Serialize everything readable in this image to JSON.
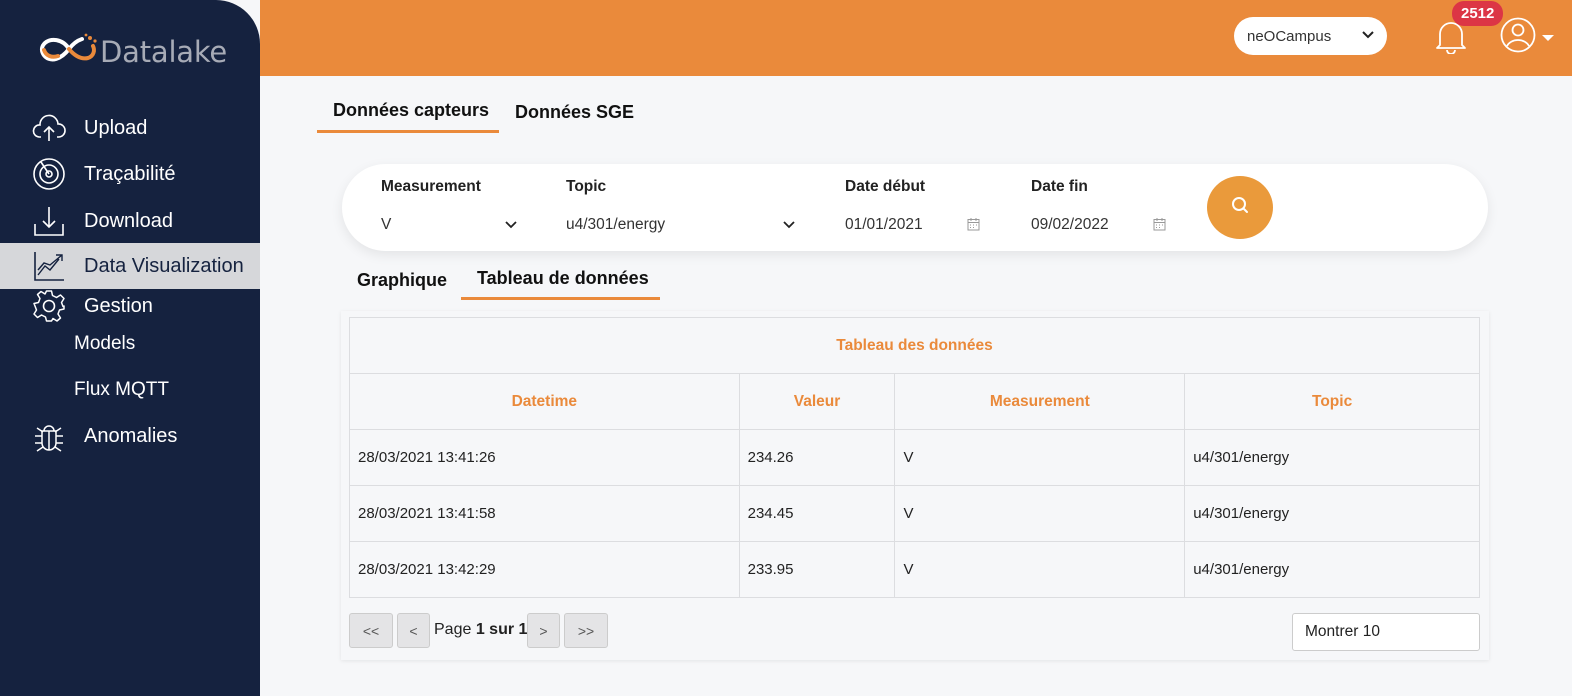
{
  "brand": {
    "name": "Datalake"
  },
  "sidebar": {
    "items": [
      {
        "label": "Upload",
        "icon": "cloud-upload-icon"
      },
      {
        "label": "Traçabilité",
        "icon": "radar-icon"
      },
      {
        "label": "Download",
        "icon": "download-icon"
      },
      {
        "label": "Data Visualization",
        "icon": "chart-line-icon",
        "active": true
      },
      {
        "label": "Gestion",
        "icon": "gear-icon"
      },
      {
        "label": "Anomalies",
        "icon": "bug-icon"
      }
    ],
    "sub_items": [
      {
        "label": "Models"
      },
      {
        "label": "Flux MQTT"
      }
    ]
  },
  "topbar": {
    "org_select": "neOCampus",
    "notification_count": "2512",
    "accent_color": "#ea8a3b"
  },
  "main_tabs": [
    {
      "label": "Données capteurs",
      "active": true
    },
    {
      "label": "Données SGE",
      "active": false
    }
  ],
  "filters": {
    "measurement": {
      "label": "Measurement",
      "value": "V"
    },
    "topic": {
      "label": "Topic",
      "value": "u4/301/energy"
    },
    "date_start": {
      "label": "Date début",
      "value": "01/01/2021"
    },
    "date_end": {
      "label": "Date fin",
      "value": "09/02/2022"
    }
  },
  "sub_tabs": [
    {
      "label": "Graphique",
      "active": false
    },
    {
      "label": "Tableau de données",
      "active": true
    }
  ],
  "table": {
    "title": "Tableau des données",
    "columns": [
      "Datetime",
      "Valeur",
      "Measurement",
      "Topic"
    ],
    "rows": [
      [
        "28/03/2021 13:41:26",
        "234.26",
        "V",
        "u4/301/energy"
      ],
      [
        "28/03/2021 13:41:58",
        "234.45",
        "V",
        "u4/301/energy"
      ],
      [
        "28/03/2021 13:42:29",
        "233.95",
        "V",
        "u4/301/energy"
      ]
    ]
  },
  "pagination": {
    "first": "<<",
    "prev": "<",
    "next": ">",
    "last": ">>",
    "page_prefix": "Page",
    "page_current": "1 sur 1",
    "show_select": "Montrer 10"
  }
}
